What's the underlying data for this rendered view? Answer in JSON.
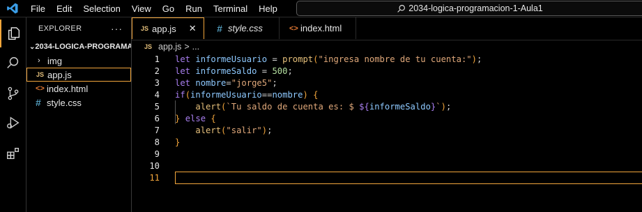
{
  "menu": [
    "File",
    "Edit",
    "Selection",
    "View",
    "Go",
    "Run",
    "Terminal",
    "Help"
  ],
  "command_center": "2034-logica-programacion-1-Aula1",
  "explorer": {
    "title": "EXPLORER",
    "more": "···",
    "folder": "2034-LOGICA-PROGRAMA...",
    "items": [
      {
        "label": "img",
        "icon": "chevron-right-icon"
      },
      {
        "label": "app.js",
        "icon": "js-file-icon"
      },
      {
        "label": "index.html",
        "icon": "html-file-icon"
      },
      {
        "label": "style.css",
        "icon": "css-file-icon"
      }
    ]
  },
  "tabs": [
    {
      "label": "app.js",
      "icon": "JS"
    },
    {
      "label": "style.css",
      "icon": "#"
    },
    {
      "label": "index.html",
      "icon": "<>"
    }
  ],
  "breadcrumb": {
    "file": "app.js",
    "sep": ">",
    "rest": "..."
  },
  "icons": {
    "js": "JS",
    "css": "#",
    "html": "<>"
  },
  "code_lines": [
    "let informeUsuario = prompt(\"ingresa nombre de tu cuenta:\");",
    "let informeSaldo = 500;",
    "let nombre=\"jorge5\";",
    "if(informeUsuario==nombre) {",
    "    alert(`Tu saldo de cuenta es: $ ${informeSaldo}`);",
    "} else {",
    "    alert(\"salir\");",
    "}",
    "",
    "",
    ""
  ],
  "line_numbers": [
    "1",
    "2",
    "3",
    "4",
    "5",
    "6",
    "7",
    "8",
    "9",
    "10",
    "11"
  ],
  "colors": {
    "accent": "#f3a63b",
    "keyword": "#a97ff0",
    "variable": "#8ec9ff",
    "string": "#e0a87a"
  }
}
